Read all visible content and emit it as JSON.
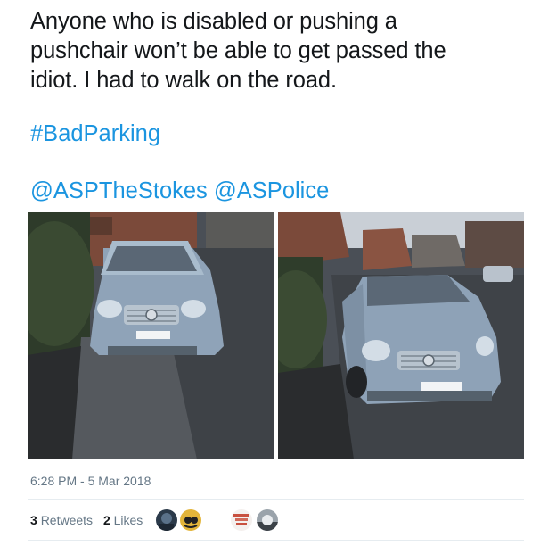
{
  "tweet": {
    "lines": [
      "Anyone who is disabled or pushing a",
      "pushchair won’t be able to get passed the",
      "idiot. I had to walk on the road."
    ],
    "hashtag": "#BadParking",
    "mentions": [
      "@ASPTheStokes",
      "@ASPolice"
    ],
    "timestamp": "6:28 PM - 5 Mar 2018"
  },
  "stats": {
    "retweets_count": "3",
    "retweets_label": "Retweets",
    "likes_count": "2",
    "likes_label": "Likes"
  },
  "colors": {
    "text": "#14171a",
    "link": "#1b95e0",
    "muted": "#657786",
    "divider": "#e6ecf0"
  },
  "media": {
    "photos": [
      "silver-car-on-pavement-front",
      "silver-car-on-pavement-side"
    ]
  },
  "avatars": [
    "avatar-dark-blue",
    "avatar-cartoon",
    "avatar-badge",
    "avatar-landscape"
  ]
}
